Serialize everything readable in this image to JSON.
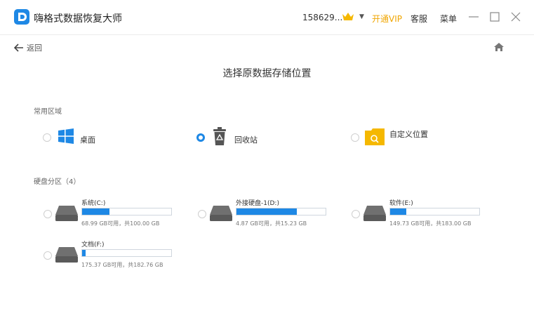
{
  "header": {
    "app_title": "嗨格式数据恢复大师",
    "user_id": "158629...",
    "vip_link": "开通VIP",
    "service_link": "客服",
    "menu_link": "菜单",
    "accent_color": "#1e88e5",
    "vip_color": "#f0a500"
  },
  "nav": {
    "back_label": "返回",
    "home_icon": "home-icon"
  },
  "page_title": "选择原数据存储位置",
  "common": {
    "label": "常用区域",
    "items": [
      {
        "label": "桌面",
        "icon": "windows-icon",
        "selected": false
      },
      {
        "label": "回收站",
        "icon": "recycle-bin-icon",
        "selected": true
      },
      {
        "label": "自定义位置",
        "icon": "folder-search-icon",
        "selected": false
      }
    ]
  },
  "disks": {
    "label": "硬盘分区（4）",
    "items": [
      {
        "name": "系统(C:)",
        "usage": "68.99 GB可用，共100.00 GB",
        "used_fraction": 0.31
      },
      {
        "name": "外接硬盘-1(D:)",
        "usage": "4.87 GB可用，共15.23 GB",
        "used_fraction": 0.68
      },
      {
        "name": "软件(E:)",
        "usage": "149.73 GB可用，共183.00 GB",
        "used_fraction": 0.18
      },
      {
        "name": "文档(F:)",
        "usage": "175.37 GB可用，共182.76 GB",
        "used_fraction": 0.04
      }
    ]
  }
}
